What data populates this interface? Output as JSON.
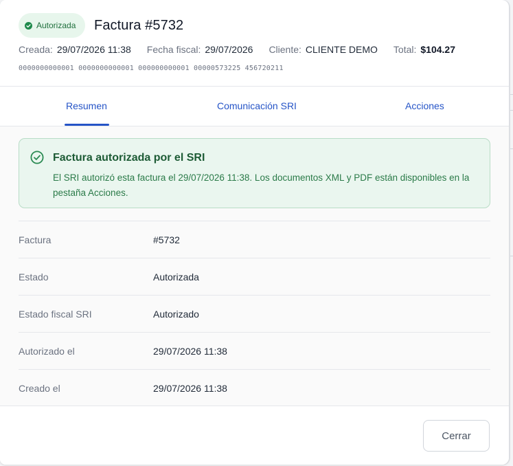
{
  "header": {
    "status_badge": "Autorizada",
    "title": "Factura #5732",
    "meta": {
      "created_label": "Creada:",
      "created_value": "29/07/2026 11:38",
      "fiscal_date_label": "Fecha fiscal:",
      "fiscal_date_value": "29/07/2026",
      "client_label": "Cliente:",
      "client_value": "CLIENTE DEMO",
      "total_label": "Total:",
      "total_value": "$104.27"
    },
    "codes": "0000000000001 0000000000001 000000000001 00000573225 456720211"
  },
  "tabs": [
    {
      "label": "Resumen",
      "active": true
    },
    {
      "label": "Comunicación SRI",
      "active": false
    },
    {
      "label": "Acciones",
      "active": false
    }
  ],
  "alert": {
    "title": "Factura autorizada por el SRI",
    "text": "El SRI autorizó esta factura el 29/07/2026 11:38. Los documentos XML y PDF están disponibles en la pestaña Acciones."
  },
  "details": [
    {
      "label": "Factura",
      "value": "#5732"
    },
    {
      "label": "Estado",
      "value": "Autorizada"
    },
    {
      "label": "Estado fiscal SRI",
      "value": "Autorizado"
    },
    {
      "label": "Autorizado el",
      "value": "29/07/2026 11:38"
    },
    {
      "label": "Creado el",
      "value": "29/07/2026 11:38"
    }
  ],
  "footer": {
    "close_label": "Cerrar"
  },
  "colors": {
    "accent": "#2554c7",
    "success": "#1f6f3c",
    "success_bg": "#eaf6ef"
  }
}
